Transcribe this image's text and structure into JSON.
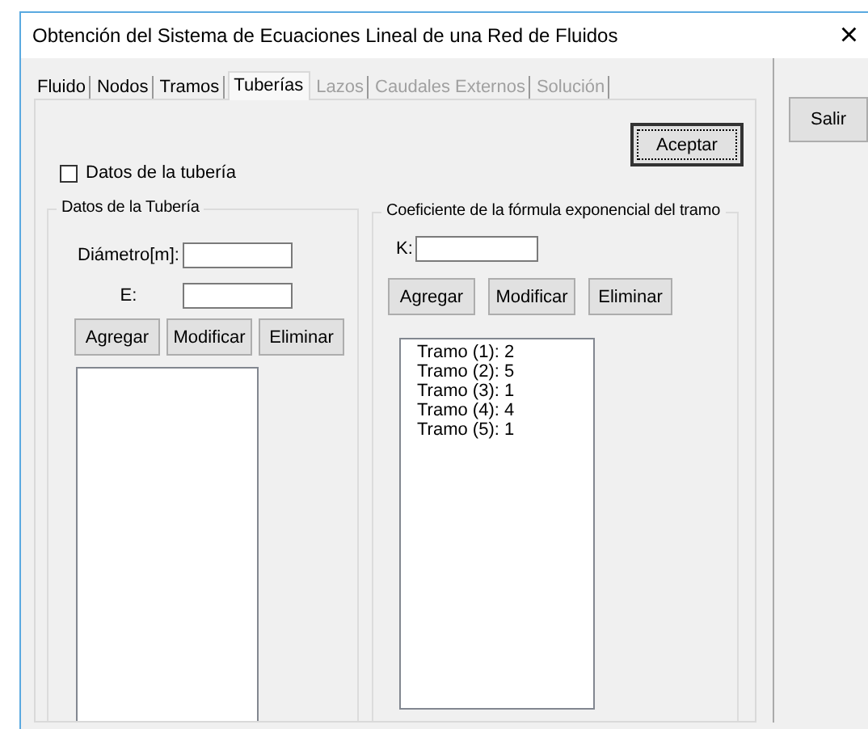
{
  "window": {
    "title": "Obtención del Sistema de Ecuaciones Lineal de una Red de Fluidos",
    "close": "×"
  },
  "tabs": [
    {
      "label": "Fluido",
      "selected": false,
      "disabled": false
    },
    {
      "label": "Nodos",
      "selected": false,
      "disabled": false
    },
    {
      "label": "Tramos",
      "selected": false,
      "disabled": false
    },
    {
      "label": "Tuberías",
      "selected": true,
      "disabled": false
    },
    {
      "label": "Lazos",
      "selected": false,
      "disabled": true
    },
    {
      "label": "Caudales Externos",
      "selected": false,
      "disabled": true
    },
    {
      "label": "Solución",
      "selected": false,
      "disabled": true
    }
  ],
  "accept_button": {
    "label": "Aceptar",
    "default": true
  },
  "exit_button": {
    "label": "Salir"
  },
  "checkbox": {
    "label": "Datos de la tubería",
    "checked": false
  },
  "pipe_group": {
    "title": "Datos de la Tubería",
    "fields": [
      {
        "label": "Diámetro[m]:"
      },
      {
        "label": "E:"
      }
    ],
    "buttons": [
      "Agregar",
      "Modificar",
      "Eliminar"
    ]
  },
  "coef_group": {
    "title": "Coeficiente de la fórmula exponencial del tramo",
    "fields": [
      {
        "label": "K:"
      }
    ],
    "buttons": [
      "Agregar",
      "Modificar",
      "Eliminar"
    ],
    "list": [
      "Tramo (1): 2",
      "Tramo (2): 5",
      "Tramo (3): 1",
      "Tramo (4): 4",
      "Tramo (5): 1"
    ]
  }
}
